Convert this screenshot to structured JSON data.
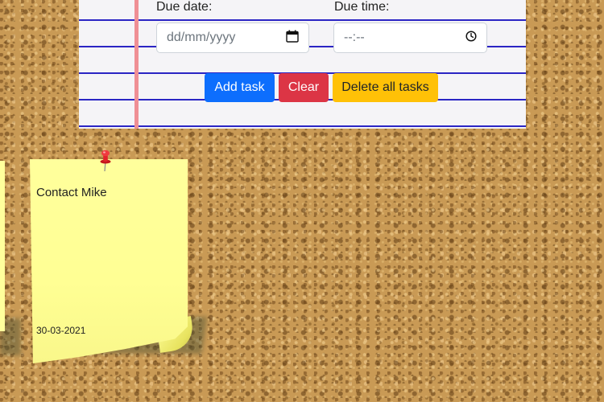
{
  "form": {
    "due_date_label": "Due date:",
    "due_date_placeholder": "dd/mm/yyyy",
    "due_time_label": "Due time:",
    "due_time_placeholder": "--:--",
    "buttons": {
      "add": "Add task",
      "clear": "Clear",
      "delete_all": "Delete all tasks"
    }
  },
  "notes": [
    {
      "title": "Contact Mike",
      "date": "30-03-2021"
    }
  ],
  "colors": {
    "add_button": "#0d6efd",
    "clear_button": "#dc3545",
    "delete_button": "#ffc107",
    "note": "#ffff9c",
    "notebook_line": "#2b25c4",
    "margin_line": "#ef8f95"
  },
  "icons": {
    "date": "calendar-icon",
    "time": "clock-icon",
    "pin": "pushpin-icon"
  }
}
